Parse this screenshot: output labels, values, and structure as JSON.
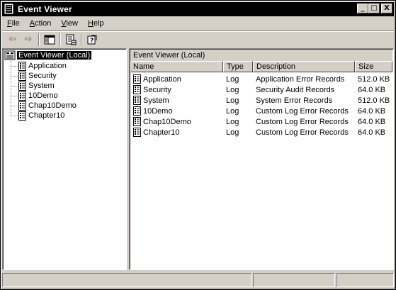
{
  "window": {
    "title": "Event Viewer",
    "controls": {
      "minimize": "_",
      "maximize": "□",
      "close": "X"
    }
  },
  "menu": [
    {
      "label": "File",
      "mnemonic": "F"
    },
    {
      "label": "Action",
      "mnemonic": "A"
    },
    {
      "label": "View",
      "mnemonic": "V"
    },
    {
      "label": "Help",
      "mnemonic": "H"
    }
  ],
  "toolbar": {
    "icons": [
      "back-arrow-icon",
      "forward-arrow-icon",
      "show-hide-tree-icon",
      "properties-icon",
      "help-icon"
    ]
  },
  "tree": {
    "root": "Event Viewer (Local)",
    "items": [
      "Application",
      "Security",
      "System",
      "10Demo",
      "Chap10Demo",
      "Chapter10"
    ]
  },
  "list": {
    "header": "Event Viewer (Local)",
    "columns": [
      "Name",
      "Type",
      "Description",
      "Size"
    ],
    "rows": [
      {
        "name": "Application",
        "type": "Log",
        "description": "Application Error Records",
        "size": "512.0 KB"
      },
      {
        "name": "Security",
        "type": "Log",
        "description": "Security Audit Records",
        "size": "64.0 KB"
      },
      {
        "name": "System",
        "type": "Log",
        "description": "System Error Records",
        "size": "512.0 KB"
      },
      {
        "name": "10Demo",
        "type": "Log",
        "description": "Custom Log Error Records",
        "size": "64.0 KB"
      },
      {
        "name": "Chap10Demo",
        "type": "Log",
        "description": "Custom Log Error Records",
        "size": "64.0 KB"
      },
      {
        "name": "Chapter10",
        "type": "Log",
        "description": "Custom Log Error Records",
        "size": "64.0 KB"
      }
    ]
  },
  "colors": {
    "face": "#d4d0c8",
    "shadow": "#808080",
    "highlight": "#ffffff",
    "selection": "#000000"
  }
}
